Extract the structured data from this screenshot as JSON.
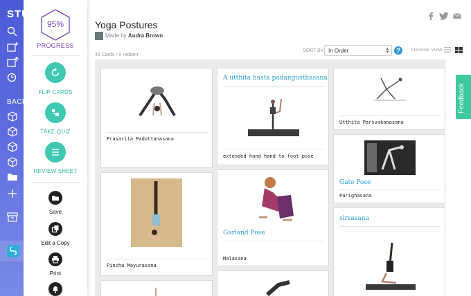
{
  "app": {
    "brand": "STU"
  },
  "nav": {
    "section_label": "BACK"
  },
  "panel": {
    "progress_value": "95%",
    "progress_label": "PROGRESS",
    "flip_cards": "FLIP CARDS",
    "take_quiz": "TAKE QUIZ",
    "review_sheet": "REVIEW SHEET",
    "save": "Save",
    "edit_copy": "Edit a Copy",
    "print": "Print"
  },
  "header": {
    "title": "Yoga Postures",
    "made_by": "Made by",
    "author": "Audra Brown",
    "counts": "43 Cards / 0 Hidden",
    "sort_label": "SORT BY",
    "sort_value": "In Order",
    "help": "?",
    "change_view": "CHANGE VIEW"
  },
  "feedback": "Feedback",
  "cards": {
    "c1": {
      "caption": "Prasarita Padottanasana"
    },
    "c2": {
      "heading": "A utthita hasta padangusthasana",
      "caption": "extended hand hand to foot pose"
    },
    "c3": {
      "caption": "Utthita Parsvakonasana"
    },
    "c4": {
      "caption": "Pincha Mayurasana"
    },
    "c5": {
      "heading": "Garland Pose",
      "caption": "Malasana"
    },
    "c6": {
      "heading": "Gate Pose",
      "caption": "Parighasana"
    },
    "c7": {
      "heading": "sirsasana"
    }
  },
  "colors": {
    "accent": "#3ec9b0",
    "purple": "#7b3fb8",
    "link": "#2a9fd6",
    "nav": "#5563dd"
  }
}
